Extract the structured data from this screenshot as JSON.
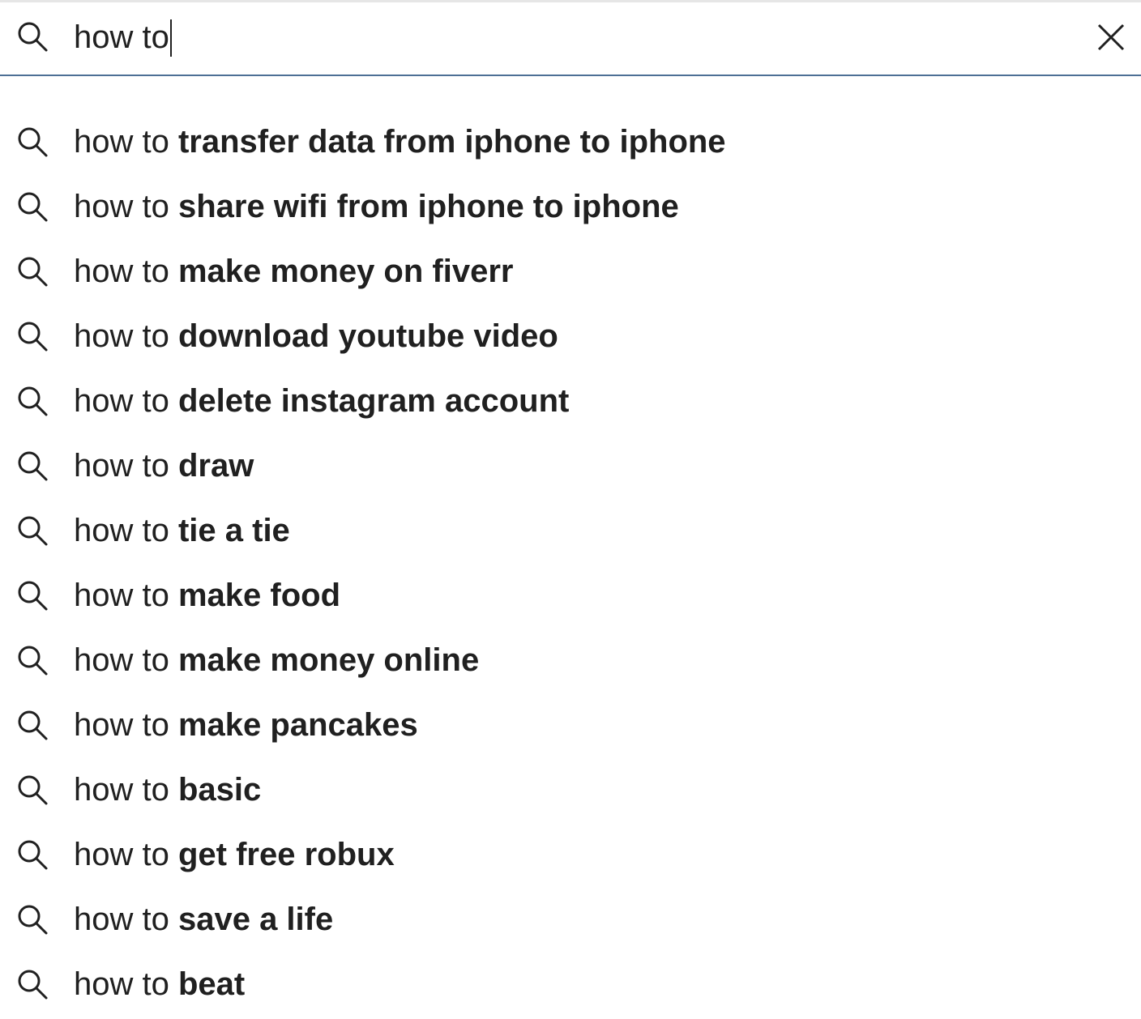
{
  "search": {
    "query": "how to",
    "icon": "search-icon",
    "clear_icon": "close-icon"
  },
  "suggestions": [
    {
      "prefix": "how to ",
      "completion": "transfer data from iphone to iphone"
    },
    {
      "prefix": "how to ",
      "completion": "share wifi from iphone to iphone"
    },
    {
      "prefix": "how to ",
      "completion": "make money on fiverr"
    },
    {
      "prefix": "how to ",
      "completion": "download youtube video"
    },
    {
      "prefix": "how to ",
      "completion": "delete instagram account"
    },
    {
      "prefix": "how to ",
      "completion": "draw"
    },
    {
      "prefix": "how to ",
      "completion": "tie a tie"
    },
    {
      "prefix": "how to ",
      "completion": "make food"
    },
    {
      "prefix": "how to ",
      "completion": "make money online"
    },
    {
      "prefix": "how to ",
      "completion": "make pancakes"
    },
    {
      "prefix": "how to ",
      "completion": "basic"
    },
    {
      "prefix": "how to ",
      "completion": "get free robux"
    },
    {
      "prefix": "how to ",
      "completion": "save a life"
    },
    {
      "prefix": "how to ",
      "completion": "beat"
    }
  ],
  "colors": {
    "text": "#202020",
    "underline": "#4d6f95",
    "background": "#ffffff"
  }
}
